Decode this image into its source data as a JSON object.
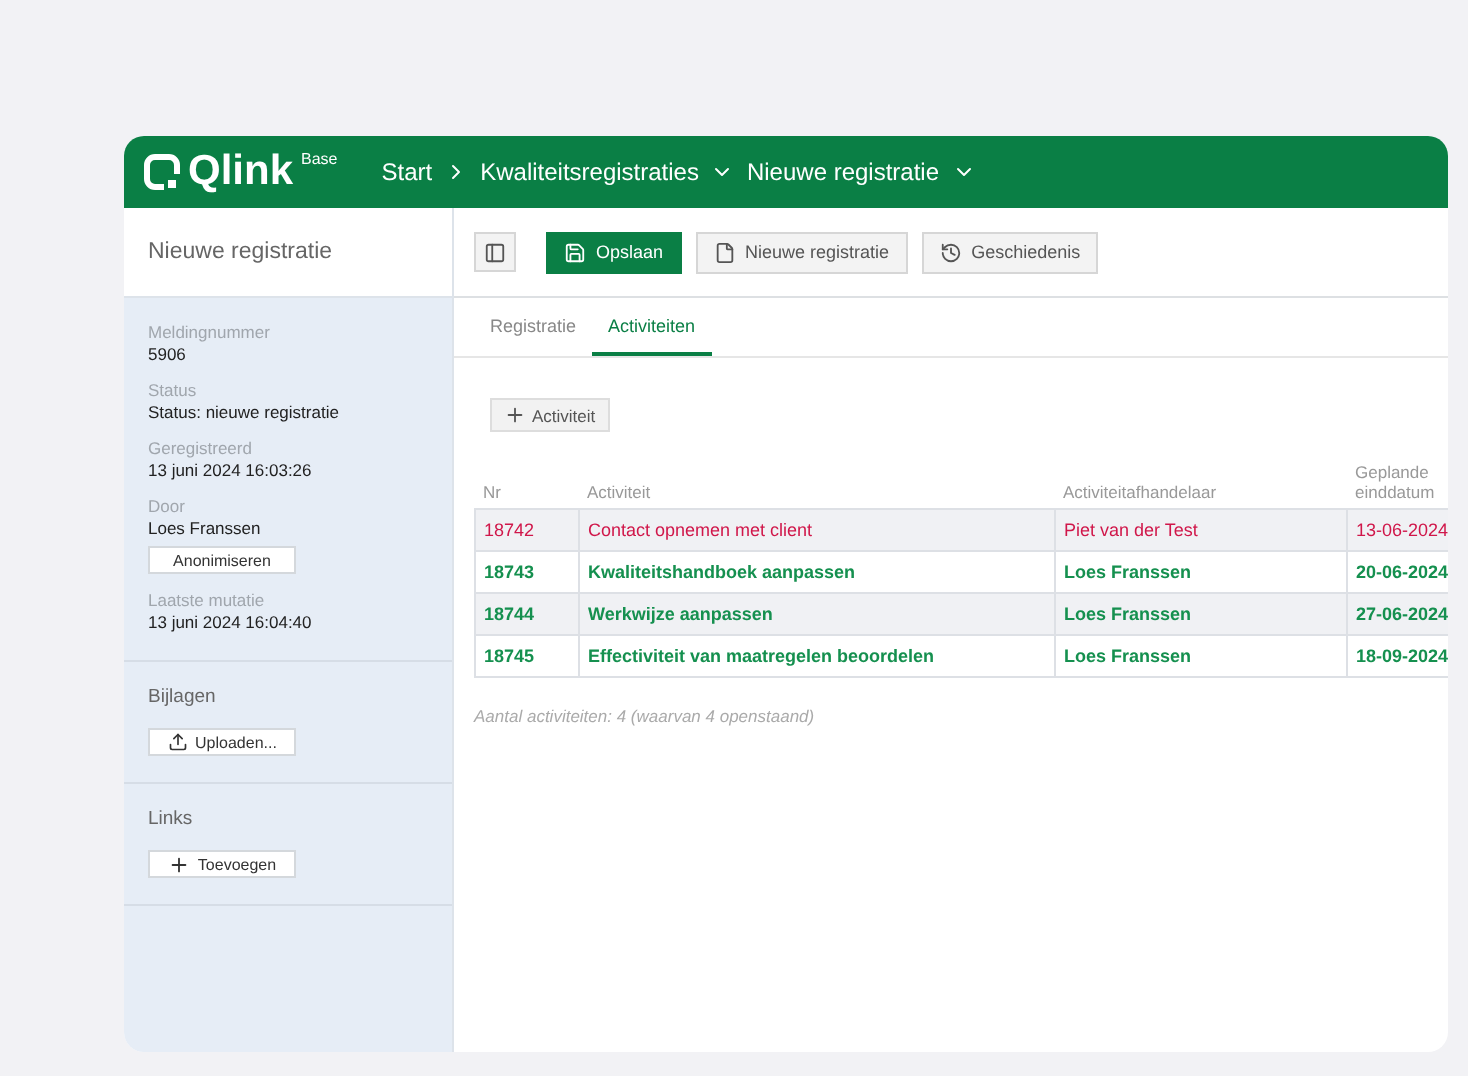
{
  "header": {
    "logo": "Qlink",
    "edition": "Base",
    "breadcrumb": [
      {
        "label": "Start",
        "has_menu": false
      },
      {
        "label": "Kwaliteitsregistraties",
        "has_menu": true
      },
      {
        "label": "Nieuwe registratie",
        "has_menu": true
      }
    ]
  },
  "sidebar": {
    "title": "Nieuwe registratie",
    "fields": [
      {
        "label": "Meldingnummer",
        "value": "5906"
      },
      {
        "label": "Status",
        "value": "Status: nieuwe registratie"
      },
      {
        "label": "Geregistreerd",
        "value": "13 juni 2024 16:03:26"
      },
      {
        "label": "Door",
        "value": "Loes Franssen",
        "button": "Anonimiseren"
      },
      {
        "label": "Laatste mutatie",
        "value": "13 juni 2024 16:04:40"
      }
    ],
    "sections": [
      {
        "title": "Bijlagen",
        "button": "Uploaden..."
      },
      {
        "title": "Links",
        "button": "Toevoegen"
      }
    ]
  },
  "toolbar": [
    {
      "label": "Opslaan",
      "primary": true
    },
    {
      "label": "Nieuwe registratie",
      "primary": false
    },
    {
      "label": "Geschiedenis",
      "primary": false
    }
  ],
  "tabs": [
    {
      "label": "Registratie",
      "selected": false
    },
    {
      "label": "Activiteiten",
      "selected": true
    }
  ],
  "add_button": "Activiteit",
  "table": {
    "columns": [
      "Nr",
      "Activiteit",
      "Activiteitafhandelaar",
      "Geplande einddatum"
    ],
    "rows": [
      {
        "overdue": true,
        "cells": [
          "18742",
          "Contact opnemen met client",
          "Piet van der Test",
          "13-06-2024"
        ]
      },
      {
        "overdue": false,
        "cells": [
          "18743",
          "Kwaliteitshandboek aanpassen",
          "Loes Franssen",
          "20-06-2024"
        ]
      },
      {
        "overdue": false,
        "cells": [
          "18744",
          "Werkwijze aanpassen",
          "Loes Franssen",
          "27-06-2024"
        ]
      },
      {
        "overdue": false,
        "cells": [
          "18745",
          "Effectiviteit van maatregelen beoordelen",
          "Loes Franssen",
          "18-09-2024"
        ]
      }
    ]
  },
  "summary": "Aantal activiteiten: 4 (waarvan 4 openstaand)"
}
